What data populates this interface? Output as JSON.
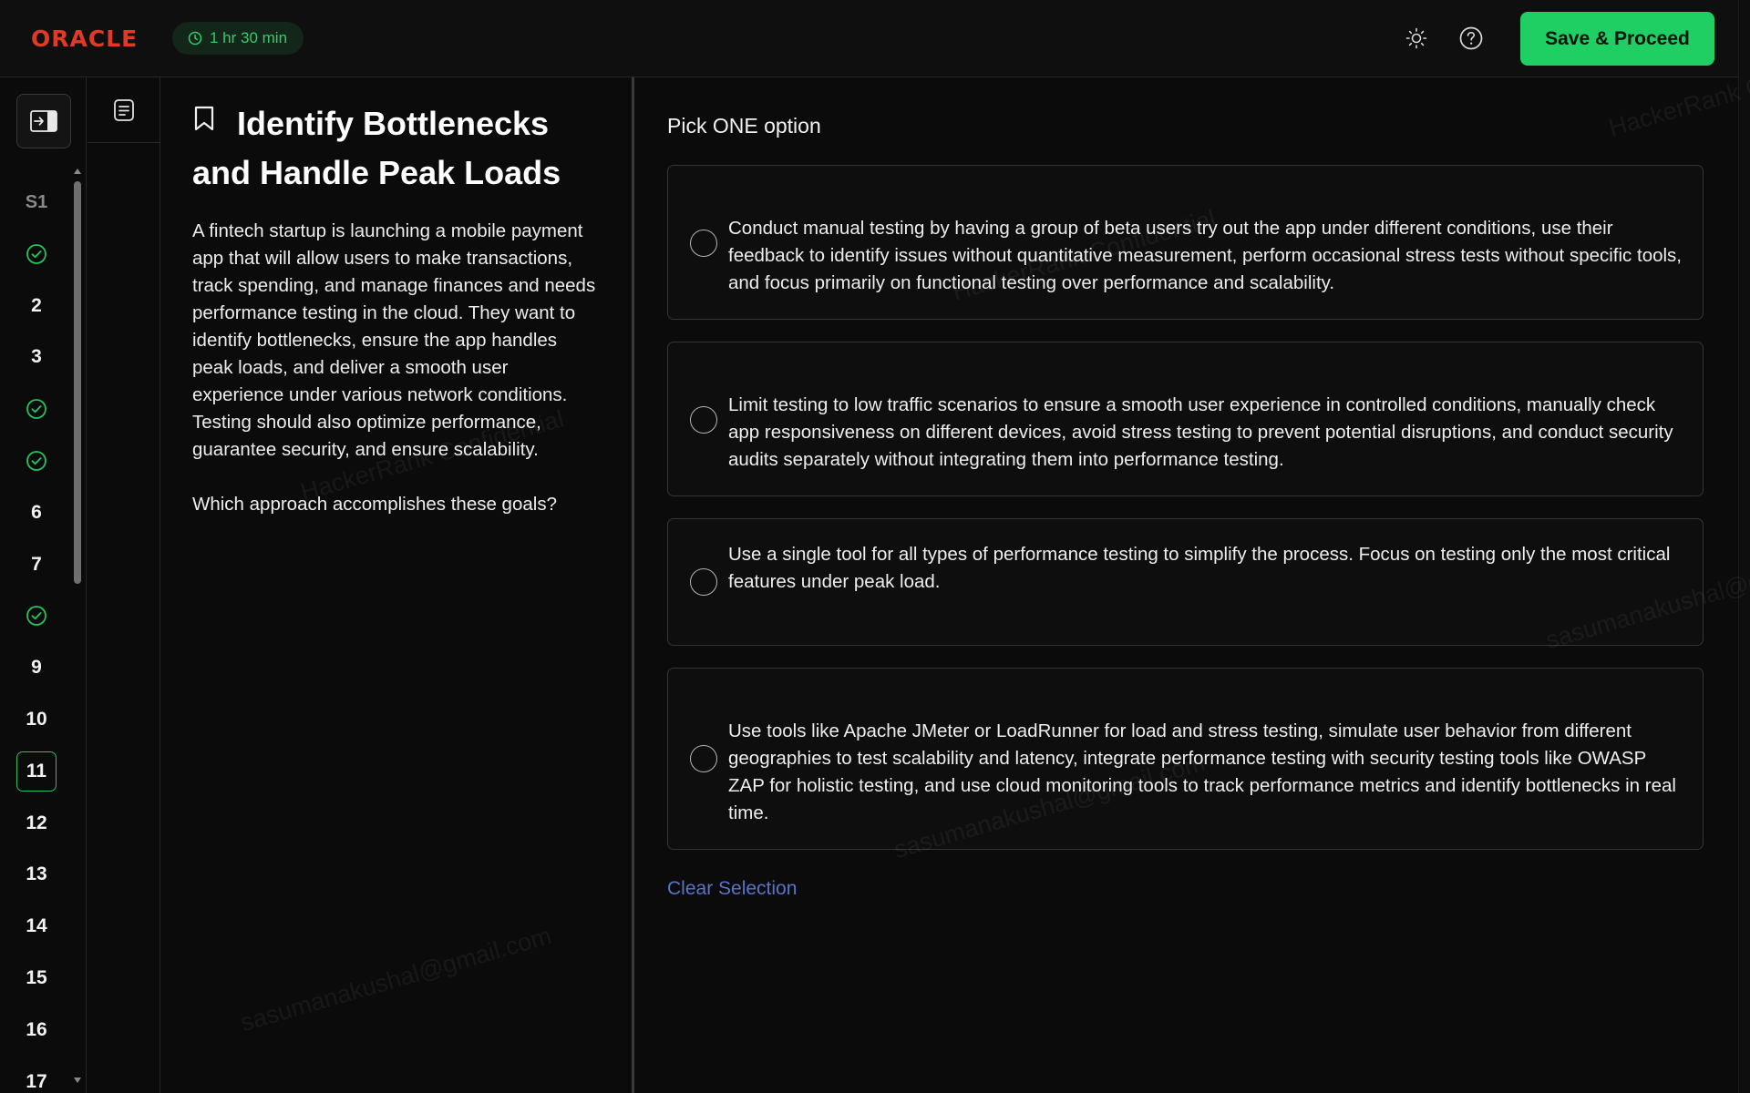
{
  "header": {
    "logo": "ORACLE",
    "timer": "1 hr 30 min",
    "save_label": "Save & Proceed",
    "theme_icon": "sun-icon",
    "help_icon": "help-circle-icon"
  },
  "colors": {
    "accent_green": "#1fcf63",
    "brand_red": "#e03a24",
    "link_blue": "#5a74c8",
    "background": "#0b0b0b"
  },
  "question_nav": {
    "collapse_icon": "sidebar-expand-icon",
    "items": [
      {
        "label": "S1",
        "state": "section"
      },
      {
        "label": "",
        "state": "answered"
      },
      {
        "label": "2",
        "state": "default"
      },
      {
        "label": "3",
        "state": "default"
      },
      {
        "label": "",
        "state": "answered"
      },
      {
        "label": "",
        "state": "answered"
      },
      {
        "label": "6",
        "state": "default"
      },
      {
        "label": "7",
        "state": "default"
      },
      {
        "label": "",
        "state": "answered"
      },
      {
        "label": "9",
        "state": "default"
      },
      {
        "label": "10",
        "state": "default"
      },
      {
        "label": "11",
        "state": "current"
      },
      {
        "label": "12",
        "state": "default"
      },
      {
        "label": "13",
        "state": "default"
      },
      {
        "label": "14",
        "state": "default"
      },
      {
        "label": "15",
        "state": "default"
      },
      {
        "label": "16",
        "state": "default"
      },
      {
        "label": "17",
        "state": "default"
      }
    ]
  },
  "tools": {
    "notes_icon": "notes-icon"
  },
  "question": {
    "title": "Identify Bottlenecks and Handle Peak Loads",
    "body": "A fintech startup is launching a mobile payment app that will allow users to make transactions, track spending, and manage finances and needs performance testing in the cloud. They want to identify bottlenecks, ensure the app handles peak loads, and deliver a smooth user experience under various network conditions. Testing should also optimize performance, guarantee security, and ensure scalability.",
    "prompt": "Which approach accomplishes these goals?"
  },
  "answers": {
    "instruction": "Pick ONE option",
    "options": [
      {
        "text": "Conduct manual testing by having a group of beta users try out the app under different conditions, use their feedback to identify issues without quantitative measurement, perform occasional stress tests without specific tools, and focus primarily on functional testing over performance and scalability."
      },
      {
        "text": "Limit testing to low traffic scenarios to ensure a smooth user experience in controlled conditions, manually check app responsiveness on different devices, avoid stress testing to prevent potential disruptions, and conduct security audits separately without integrating them into performance testing."
      },
      {
        "text": " Use a single tool for all types of performance testing to simplify the process. Focus on testing only the most critical features under peak load."
      },
      {
        "text": "Use tools like Apache JMeter or LoadRunner for load and stress testing, simulate user behavior from different geographies to test scalability and latency, integrate performance testing with security testing tools like OWASP ZAP for holistic testing, and use cloud monitoring tools to track performance metrics and identify bottlenecks in real time."
      }
    ],
    "clear_label": "Clear Selection"
  },
  "watermarks": {
    "email": "sasumanakushal@gmail.com",
    "brand": "HackerRank Confidential"
  }
}
